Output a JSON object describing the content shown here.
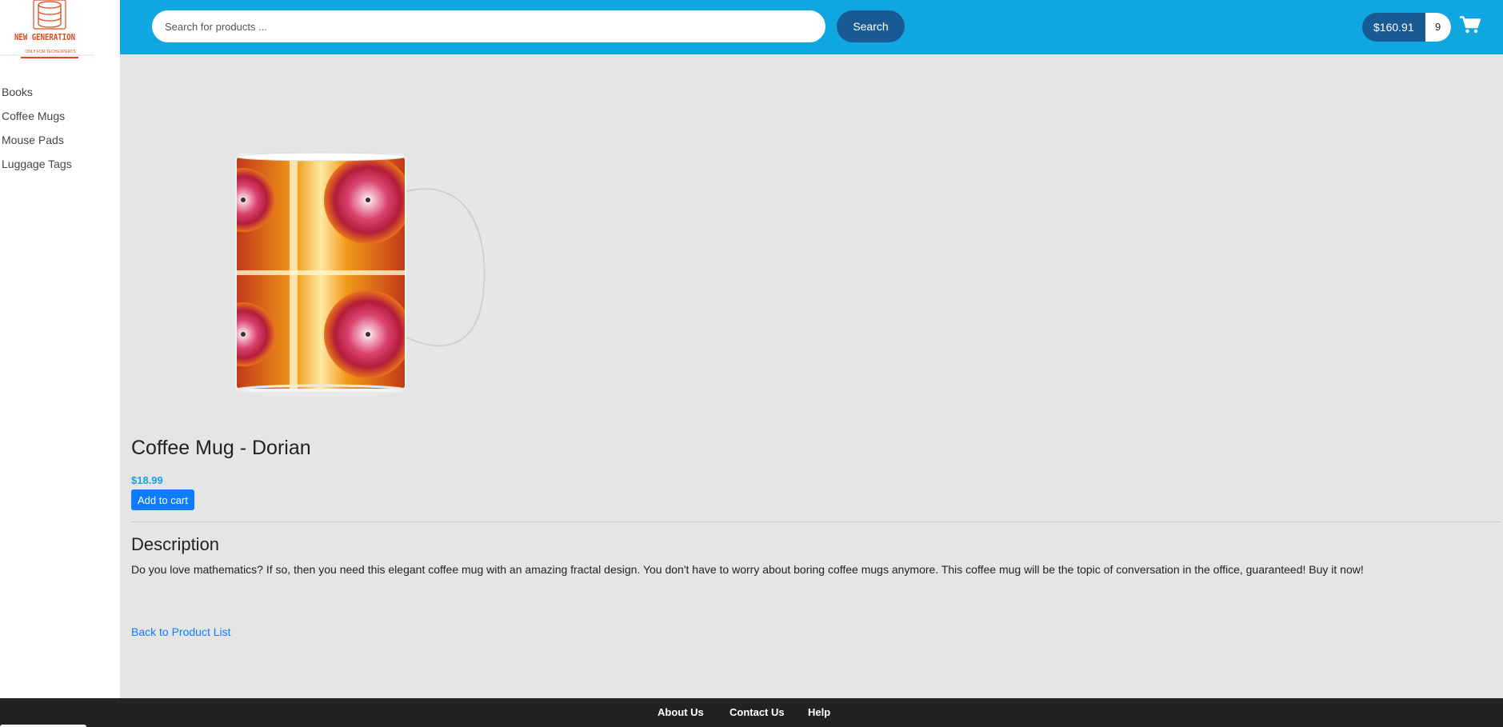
{
  "brand": {
    "logo_title": "NEW GENERATION",
    "logo_subtitle": "ONLY FOR TECHEXPERTS",
    "logo_icon": "database-icon",
    "accent_color": "#e0471d"
  },
  "sidebar": {
    "items": [
      {
        "label": "Books"
      },
      {
        "label": "Coffee Mugs"
      },
      {
        "label": "Mouse Pads"
      },
      {
        "label": "Luggage Tags"
      }
    ]
  },
  "header": {
    "background_color": "#0fa6e2",
    "search": {
      "placeholder": "Search for products ...",
      "value": ""
    },
    "search_button_label": "Search",
    "cart": {
      "total": "$160.91",
      "count": "9",
      "icon": "shopping-cart-icon"
    }
  },
  "product": {
    "image_icon": "fractal-mug-image",
    "title": "Coffee Mug - Dorian",
    "price": "$18.99",
    "price_color": "#1aa0de",
    "add_to_cart_label": "Add to cart",
    "description_heading": "Description",
    "description": "Do you love mathematics? If so, then you need this elegant coffee mug with an amazing fractal design. You don't have to worry about boring coffee mugs anymore. This coffee mug will be the topic of conversation in the office, guaranteed! Buy it now!",
    "back_link": "Back to Product List"
  },
  "footer": {
    "links": [
      {
        "label": "About Us"
      },
      {
        "label": "Contact Us"
      },
      {
        "label": "Help"
      }
    ]
  }
}
